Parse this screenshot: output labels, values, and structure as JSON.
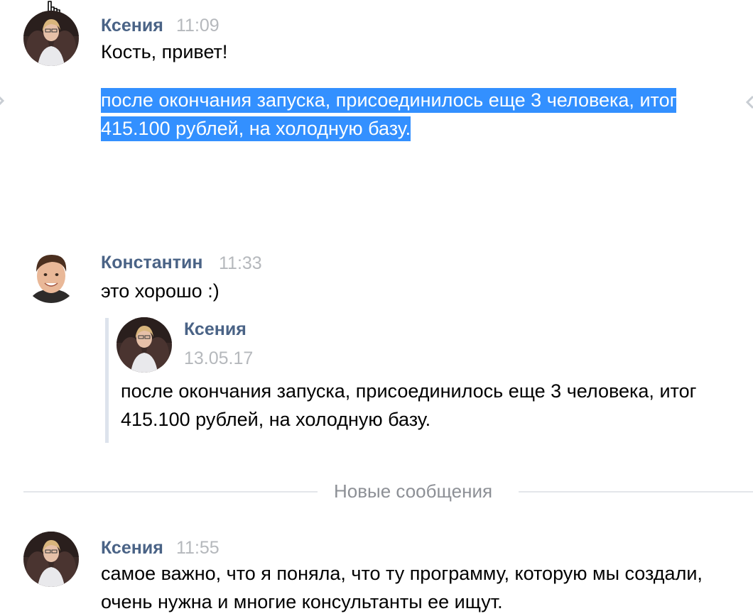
{
  "messages": [
    {
      "author": "Ксения",
      "time": "11:09",
      "lines": [
        "Кость, привет!"
      ],
      "selected_text": "после окончания запуска, присоединилось еще 3 человека, итог 415.100 рублей, на холодную базу."
    },
    {
      "author": "Константин",
      "time": "11:33",
      "text": "это хорошо :)",
      "forwarded": {
        "author": "Ксения",
        "date": "13.05.17",
        "text": "после окончания запуска, присоединилось еще 3 человека, итог 415.100 рублей, на холодную базу."
      }
    },
    {
      "author": "Ксения",
      "time": "11:55",
      "text": "самое важно, что я поняла, что ту программу, которую мы создали, очень нужна и многие консультанты ее ищут."
    }
  ],
  "divider": {
    "label": "Новые сообщения"
  },
  "icons": [
    "cursor-hand-icon",
    "left-arrow-icon",
    "right-arrow-icon"
  ],
  "colors": {
    "author": "#4a6386",
    "time": "#b5b8bc",
    "selection": "#3390ff",
    "quote_bar": "#dde3ec"
  }
}
